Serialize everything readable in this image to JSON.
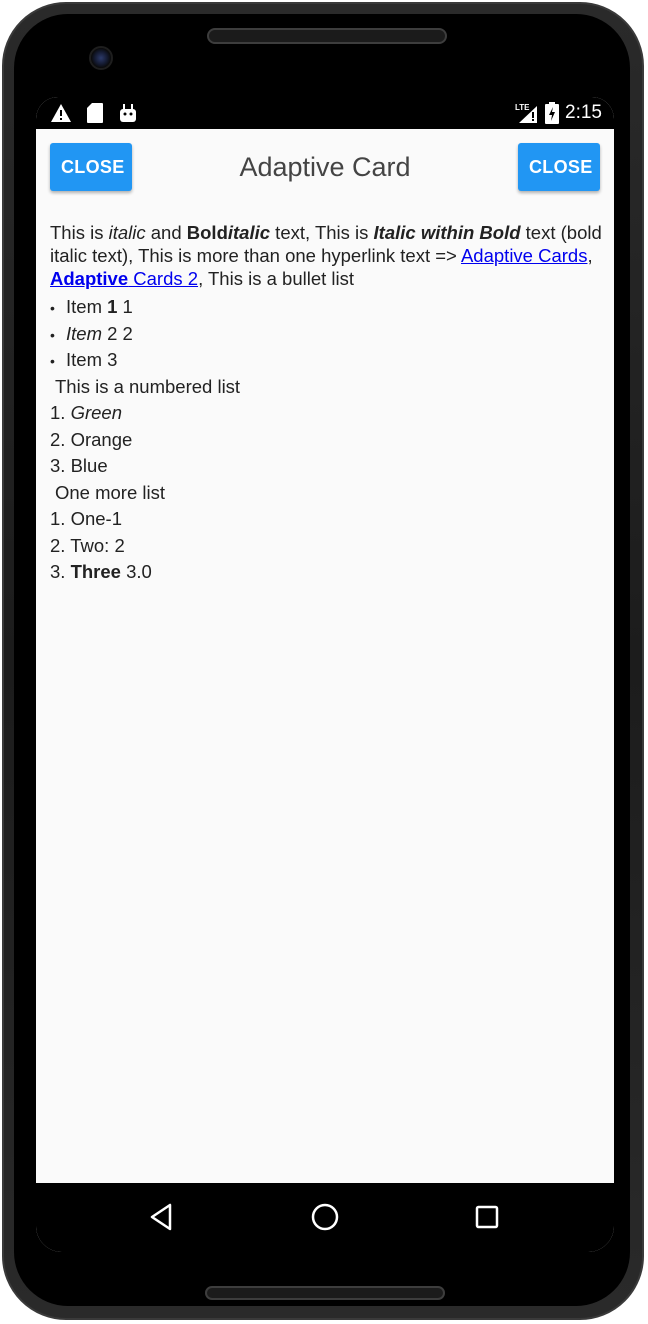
{
  "status_bar": {
    "time": "2:15",
    "network_label": "LTE",
    "icons_left": [
      "warning-icon",
      "sd-card-icon",
      "android-icon"
    ],
    "icons_right": [
      "signal-icon",
      "battery-charging-icon"
    ]
  },
  "app_bar": {
    "title": "Adaptive Card",
    "left_button_label": "CLOSE",
    "right_button_label": "CLOSE",
    "accent_color": "#2196f3"
  },
  "content": {
    "paragraph": {
      "t1": "This is ",
      "t2": "italic",
      "t3": " and ",
      "t4": "Bold",
      "t5": "italic",
      "t6": " text, This is ",
      "t7": "Italic within Bold",
      "t8": " text (bold italic text), This is more than one hyperlink text => ",
      "link1": "Adaptive Cards",
      "t9": ",  ",
      "link2_bold": "Adaptive",
      "link2_rest": " Cards 2",
      "t10": ", This is a bullet list"
    },
    "bullets": [
      {
        "a": "Item ",
        "b": "1",
        "c": " 1"
      },
      {
        "a": "Item",
        "b": " 2 2"
      },
      {
        "a": "Item 3"
      }
    ],
    "numbered_heading": "This is a numbered list",
    "numbered": [
      {
        "num": "1. ",
        "text": "Green"
      },
      {
        "num": "2. ",
        "text": "Orange"
      },
      {
        "num": "3. ",
        "text": "Blue"
      }
    ],
    "second_heading": "One more list",
    "second_list": [
      {
        "num": "1. ",
        "text": "One-1"
      },
      {
        "num": "2. ",
        "text": "Two: 2"
      },
      {
        "num": "3. ",
        "bold": "Three",
        "rest": " 3.0"
      }
    ],
    "link_color": "#0000ee"
  },
  "nav_bar": {
    "icons": [
      "back-icon",
      "home-icon",
      "recent-apps-icon"
    ]
  }
}
